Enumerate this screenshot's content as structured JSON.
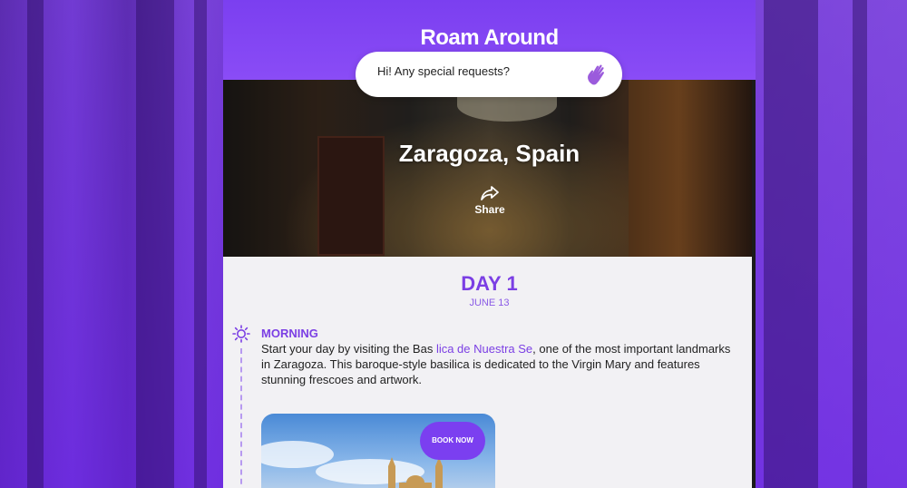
{
  "app": {
    "title": "Roam Around"
  },
  "chat": {
    "placeholder": "Hi! Any special requests?",
    "icon": "waving-hand-icon"
  },
  "hero": {
    "city": "Zaragoza, Spain",
    "share_label": "Share"
  },
  "itinerary": {
    "day_label": "DAY 1",
    "date": "JUNE 13",
    "sections": [
      {
        "period": "MORNING",
        "icon": "sun-icon",
        "text_before": "Start your day by visiting the Bas ",
        "link_text": "lica de Nuestra Se",
        "text_after": ", one of the most important landmarks in Zaragoza. This baroque-style basilica is dedicated to the Virgin Mary and features stunning frescoes and artwork.",
        "card_button": "BOOK NOW"
      }
    ]
  },
  "colors": {
    "accent": "#7b3fe4",
    "header": "#8a4cf6"
  }
}
